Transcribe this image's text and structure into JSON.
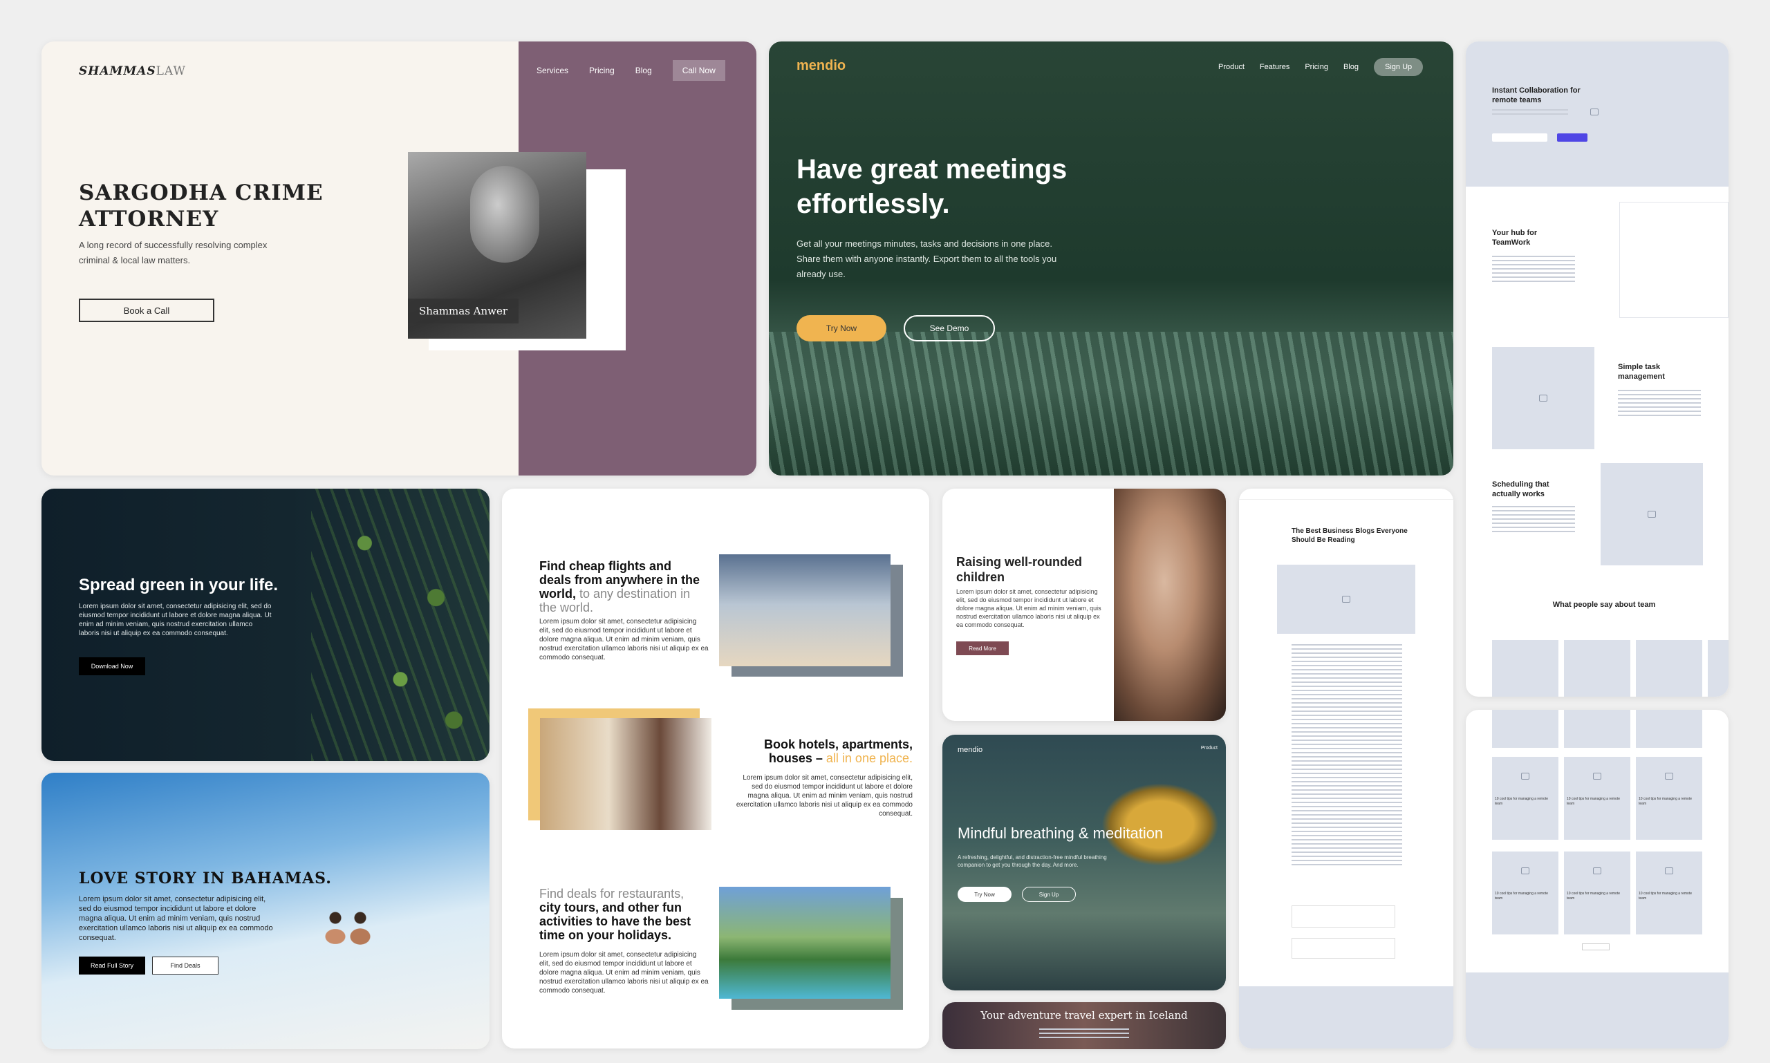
{
  "card_law": {
    "logo_bold": "SHAMMAS",
    "logo_light": "LAW",
    "nav": [
      "Services",
      "Pricing",
      "Blog"
    ],
    "nav_cta": "Call Now",
    "title_line1": "SARGODHA CRIME",
    "title_line2": "ATTORNEY",
    "subtitle": "A long record of successfully resolving complex criminal & local law matters.",
    "cta": "Book a Call",
    "name_tag": "Shammas Anwer"
  },
  "card_mendio": {
    "logo": "mendio",
    "nav": [
      "Product",
      "Features",
      "Pricing",
      "Blog"
    ],
    "nav_cta": "Sign Up",
    "title": "Have great meetings effortlessly.",
    "subtitle": "Get all your meetings minutes, tasks and decisions in one place. Share them with anyone instantly. Export them to all the tools you already use.",
    "primary": "Try Now",
    "secondary": "See Demo"
  },
  "card_team": {
    "hero_title": "Instant Collaboration for remote teams",
    "sec1": "Your hub for TeamWork",
    "sec2": "Simple task management",
    "sec3": "Scheduling that actually works",
    "testimonial": "What people say about team"
  },
  "card_green": {
    "title": "Spread green in your life.",
    "body": "Lorem ipsum dolor sit amet, consectetur adipisicing elit, sed do eiusmod tempor incididunt ut labore et dolore magna aliqua. Ut enim ad minim veniam, quis nostrud exercitation ullamco laboris nisi ut aliquip ex ea commodo consequat.",
    "cta": "Download Now"
  },
  "card_bahamas": {
    "title": "LOVE STORY IN BAHAMAS.",
    "body": "Lorem ipsum dolor sit amet, consectetur adipisicing elit, sed do eiusmod tempor incididunt ut labore et dolore magna aliqua. Ut enim ad minim veniam, quis nostrud exercitation ullamco laboris nisi ut aliquip ex ea commodo consequat.",
    "primary": "Read Full Story",
    "secondary": "Find Deals"
  },
  "card_travel": {
    "s1_bold": "Find cheap flights and deals from anywhere in the world,",
    "s1_light": " to any destination in the world.",
    "s2_bold": "Book hotels, apartments, houses –",
    "s2_accent": " all in one place.",
    "s3_light": "Find deals for restaurants,",
    "s3_bold": " city tours, and other fun activities to have the best time on your holidays.",
    "body": "Lorem ipsum dolor sit amet, consectetur adipisicing elit, sed do eiusmod tempor incididunt ut labore et dolore magna aliqua. Ut enim ad minim veniam, quis nostrud exercitation ullamco laboris nisi ut aliquip ex ea commodo consequat."
  },
  "card_children": {
    "title": "Raising well-rounded children",
    "body": "Lorem ipsum dolor sit amet, consectetur adipisicing elit, sed do eiusmod tempor incididunt ut labore et dolore magna aliqua. Ut enim ad minim veniam, quis nostrud exercitation ullamco laboris nisi ut aliquip ex ea commodo consequat.",
    "cta": "Read More"
  },
  "card_mindful": {
    "logo": "mendio",
    "nav": "Product",
    "title": "Mindful breathing & meditation",
    "body": "A refreshing, delightful, and distraction-free mindful breathing companion to get you through the day. And more.",
    "primary": "Try Now",
    "secondary": "Sign Up"
  },
  "card_iceland": {
    "title": "Your adventure travel expert in Iceland"
  },
  "card_blog": {
    "title": "The Best Business Blogs Everyone Should Be Reading"
  },
  "card_grid": {
    "tile_title": "10 cool tips for managing a remote team"
  }
}
